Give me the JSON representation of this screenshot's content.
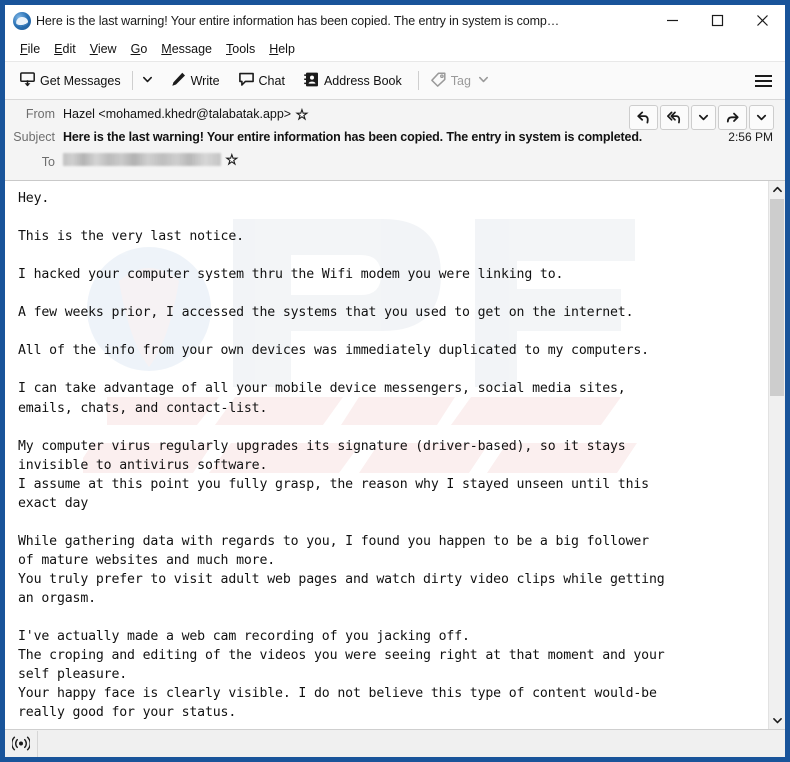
{
  "window": {
    "title": "Here is the last warning! Your entire information has been copied. The entry in system is comp…",
    "app_icon": "thunderbird-icon",
    "controls": {
      "minimize": "minimize-icon",
      "maximize": "maximize-icon",
      "close": "close-icon"
    },
    "border_color": "#19549a"
  },
  "menubar": {
    "items": [
      {
        "label": "File",
        "accel": "F"
      },
      {
        "label": "Edit",
        "accel": "E"
      },
      {
        "label": "View",
        "accel": "V"
      },
      {
        "label": "Go",
        "accel": "G"
      },
      {
        "label": "Message",
        "accel": "M"
      },
      {
        "label": "Tools",
        "accel": "T"
      },
      {
        "label": "Help",
        "accel": "H"
      }
    ]
  },
  "toolbar": {
    "get_messages_label": "Get Messages",
    "write_label": "Write",
    "chat_label": "Chat",
    "address_book_label": "Address Book",
    "tag_label": "Tag",
    "tag_disabled": true,
    "app_menu": "hamburger-icon"
  },
  "message": {
    "from_label": "From",
    "from_value": "Hazel <mohamed.khedr@talabatak.app>",
    "subject_label": "Subject",
    "subject_value": "Here is the last warning! Your entire information has been copied. The entry in system is completed.",
    "to_label": "To",
    "to_value": "",
    "to_redacted": true,
    "time": "2:56 PM",
    "actions": [
      {
        "name": "reply-button",
        "icon": "reply-icon"
      },
      {
        "name": "reply-all-button",
        "icon": "reply-all-icon"
      },
      {
        "name": "reply-more-dropdown",
        "icon": "chevron-down-icon"
      },
      {
        "name": "forward-button",
        "icon": "forward-icon"
      },
      {
        "name": "more-actions-dropdown",
        "icon": "chevron-down-icon"
      }
    ]
  },
  "body": {
    "watermark_text": "pcrisk.com",
    "text": "Hey.\n\nThis is the very last notice.\n\nI hacked your computer system thru the Wifi modem you were linking to.\n\nA few weeks prior, I accessed the systems that you used to get on the internet.\n\nAll of the info from your own devices was immediately duplicated to my computers.\n\nI can take advantage of all your mobile device messengers, social media sites,\nemails, chats, and contact-list.\n\nMy computer virus regularly upgrades its signature (driver-based), so it stays\ninvisible to antivirus software.\nI assume at this point you fully grasp, the reason why I stayed unseen until this\nexact day\n\nWhile gathering data with regards to you, I found you happen to be a big follower\nof mature websites and much more.\nYou truly prefer to visit adult web pages and watch dirty video clips while getting\nan orgasm.\n\nI've actually made a web cam recording of you jacking off.\nThe croping and editing of the videos you were seeing right at that moment and your\nself pleasure.\nYour happy face is clearly visible. I do not believe this type of content would-be\nreally good for your status."
  },
  "scrollbar": {
    "up_icon": "chevron-up-icon",
    "down_icon": "chevron-down-icon",
    "thumb_color": "#cdcdcd"
  },
  "statusbar": {
    "icon": "online-status-icon",
    "text": ""
  }
}
